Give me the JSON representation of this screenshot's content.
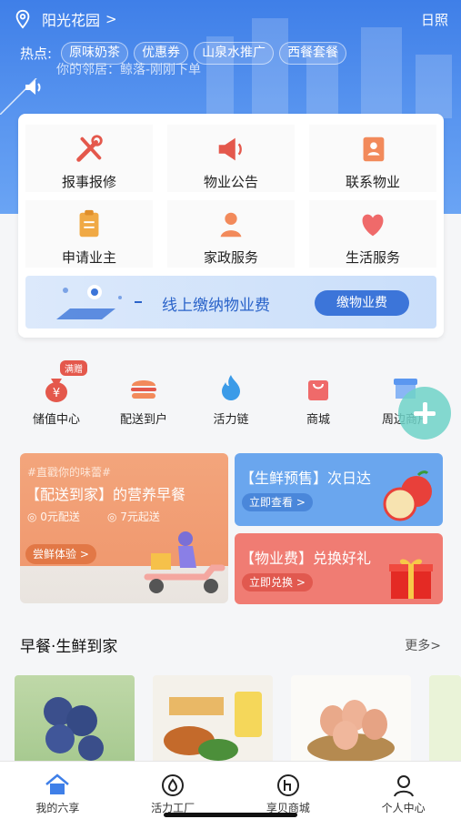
{
  "header": {
    "location": "阳光花园",
    "location_arrow": ">",
    "right_label": "日照",
    "hot_label": "热点:",
    "hot_tags": [
      "原味奶茶",
      "优惠券",
      "山泉水推广",
      "西餐套餐"
    ],
    "notice": "你的邻居：鲸落-刚刚下单"
  },
  "services": [
    {
      "label": "报事报修",
      "icon": "repair-tools-icon"
    },
    {
      "label": "物业公告",
      "icon": "megaphone-icon"
    },
    {
      "label": "联系物业",
      "icon": "contact-book-icon"
    },
    {
      "label": "申请业主",
      "icon": "clipboard-icon"
    },
    {
      "label": "家政服务",
      "icon": "housekeeper-icon"
    },
    {
      "label": "生活服务",
      "icon": "heart-icon"
    }
  ],
  "banner": {
    "text": "线上缴纳物业费",
    "button": "缴物业费"
  },
  "shortcuts": [
    {
      "label": "储值中心",
      "icon": "money-bag-icon",
      "badge": "满赠"
    },
    {
      "label": "配送到户",
      "icon": "burger-icon"
    },
    {
      "label": "活力链",
      "icon": "flame-icon"
    },
    {
      "label": "商城",
      "icon": "shopping-bag-icon"
    },
    {
      "label": "周边商户",
      "icon": "store-icon"
    }
  ],
  "promo_big": {
    "subtitle": "#直戳你的味蕾#",
    "title": "【配送到家】的营养早餐",
    "feature1": "0元配送",
    "feature2": "7元起送",
    "button": "尝鲜体验 >"
  },
  "promo_small": [
    {
      "title": "【生鲜预售】次日达",
      "button": "立即查看 >",
      "color": "#6aa6ee"
    },
    {
      "title": "【物业费】兑换好礼",
      "button": "立即兑换 >",
      "color": "#f07c73"
    }
  ],
  "section": {
    "title": "早餐·生鲜到家",
    "more": "更多>"
  },
  "nav": [
    {
      "label": "我的六享",
      "icon": "home-icon"
    },
    {
      "label": "活力工厂",
      "icon": "vitality-icon"
    },
    {
      "label": "享贝商城",
      "icon": "mall-icon"
    },
    {
      "label": "个人中心",
      "icon": "person-icon"
    }
  ],
  "colors": {
    "primary": "#3f7fe8",
    "accent_red": "#e4584c",
    "promo_orange": "#f0996f"
  }
}
